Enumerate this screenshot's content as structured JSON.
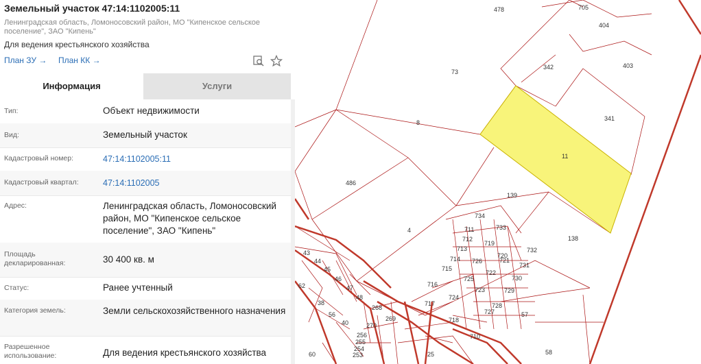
{
  "header": {
    "title": "Земельный участок 47:14:1102005:11",
    "address_line": "Ленинградская область, Ломоносовский район, МО \"Кипенское сельское поселение\", ЗАО \"Кипень\"",
    "purpose": "Для ведения крестьянского хозяйства",
    "plan_zu": "План ЗУ →",
    "plan_kk": "План КК →"
  },
  "tabs": {
    "info": "Информация",
    "services": "Услуги"
  },
  "info": {
    "type_label": "Тип:",
    "type_value": "Объект недвижимости",
    "kind_label": "Вид:",
    "kind_value": "Земельный участок",
    "cadnum_label": "Кадастровый номер:",
    "cadnum_value": "47:14:1102005:11",
    "quarter_label": "Кадастровый квартал:",
    "quarter_value": "47:14:1102005",
    "address_label": "Адрес:",
    "address_value": "Ленинградская область, Ломоносовский район, МО \"Кипенское сельское поселение\", ЗАО \"Кипень\"",
    "area_label": "Площадь декларированная:",
    "area_value": "30 400 кв. м",
    "status_label": "Статус:",
    "status_value": "Ранее учтенный",
    "category_label": "Категория земель:",
    "category_value": "Земли сельскохозяйственного назначения",
    "use_label": "Разрешенное использование:",
    "use_value": "Для ведения крестьянского хозяйства"
  },
  "map": {
    "parcels": [
      "478",
      "705",
      "404",
      "403",
      "73",
      "342",
      "341",
      "8",
      "11",
      "486",
      "139",
      "4",
      "138",
      "734",
      "733",
      "732",
      "731",
      "730",
      "729",
      "728",
      "727",
      "726",
      "725",
      "724",
      "723",
      "722",
      "721",
      "720",
      "719",
      "718",
      "717",
      "716",
      "715",
      "714",
      "713",
      "712",
      "711",
      "710",
      "57",
      "58",
      "43",
      "44",
      "45",
      "46",
      "47",
      "48",
      "38",
      "56",
      "40",
      "268",
      "269",
      "270",
      "256",
      "255",
      "254",
      "253",
      "62",
      "60",
      "25"
    ]
  },
  "icons": {
    "search": "search-map-icon",
    "favorite": "star-icon"
  },
  "colors": {
    "accent": "#2a6db5",
    "selected_parcel": "#f8f47a",
    "boundary": "#c0392b"
  }
}
